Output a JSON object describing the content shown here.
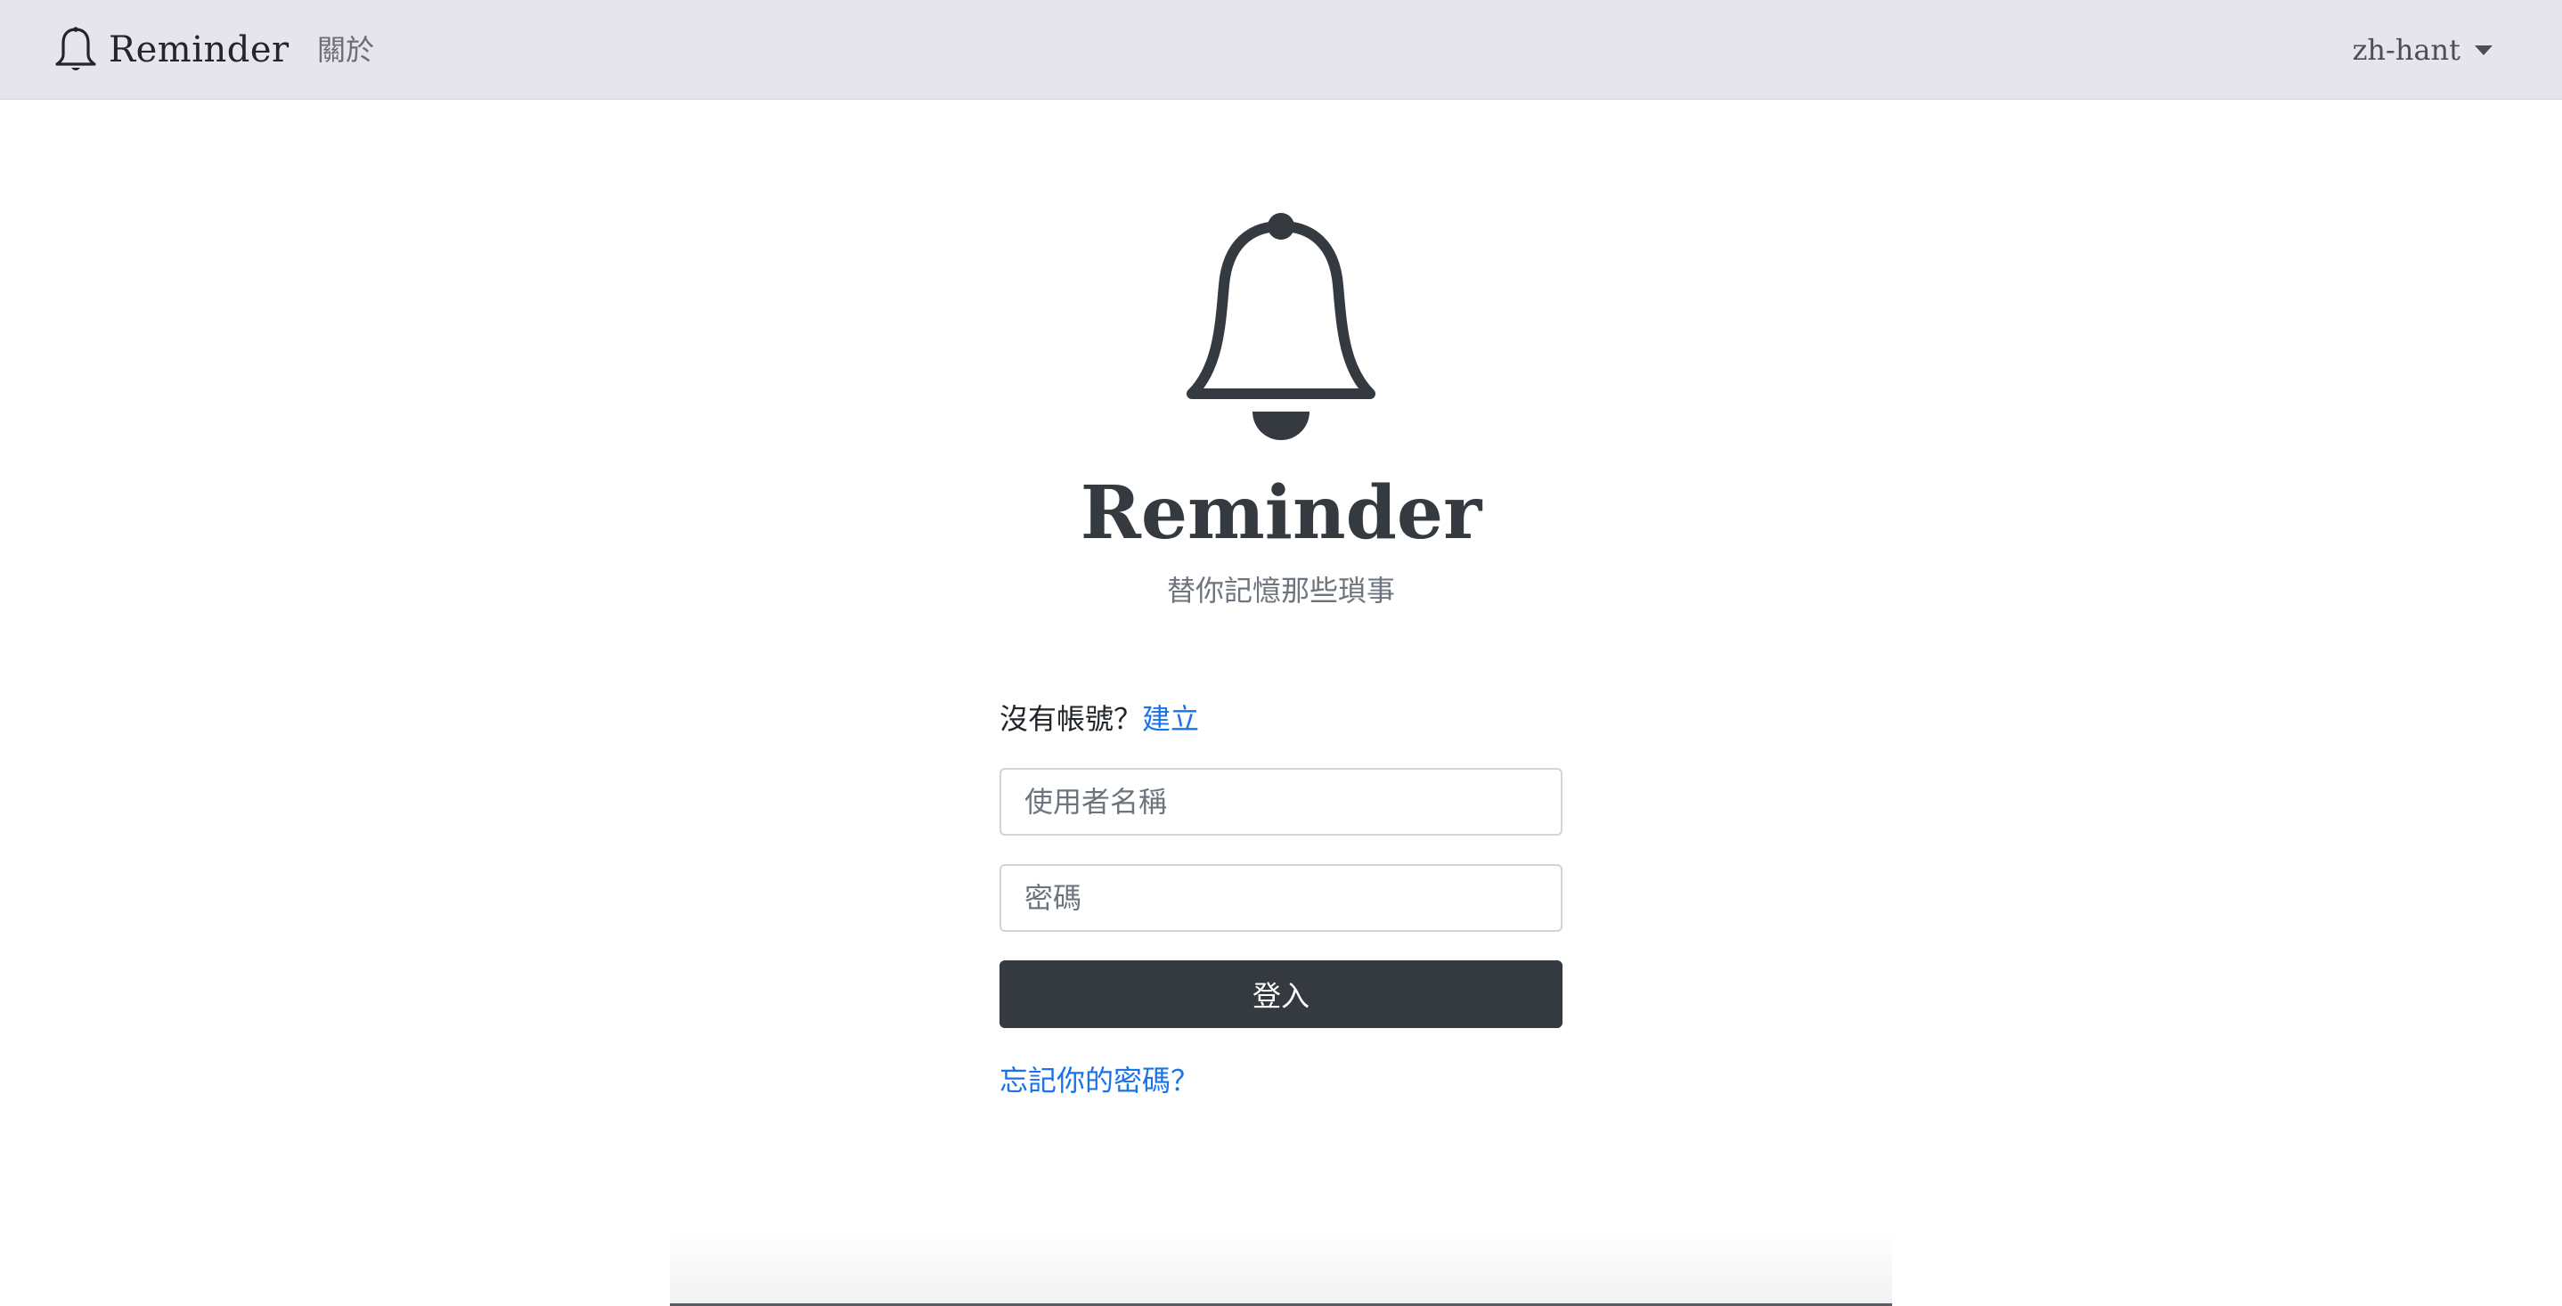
{
  "navbar": {
    "brand_icon": "bell-icon",
    "brand_text": "Reminder",
    "about_label": "關於",
    "language_label": "zh-hant",
    "language_caret_icon": "caret-down-icon",
    "background": "#e6e4ed"
  },
  "hero": {
    "icon": "bell-icon",
    "title": "Reminder",
    "tagline": "替你記憶那些瑣事"
  },
  "login": {
    "no_account_text": "沒有帳號？",
    "create_link": "建立",
    "username_placeholder": "使用者名稱",
    "password_placeholder": "密碼",
    "login_button": "登入",
    "forgot_link": "忘記你的密碼？"
  },
  "colors": {
    "link": "#1a73e8",
    "button": "#343a40",
    "heading": "#343a40"
  }
}
